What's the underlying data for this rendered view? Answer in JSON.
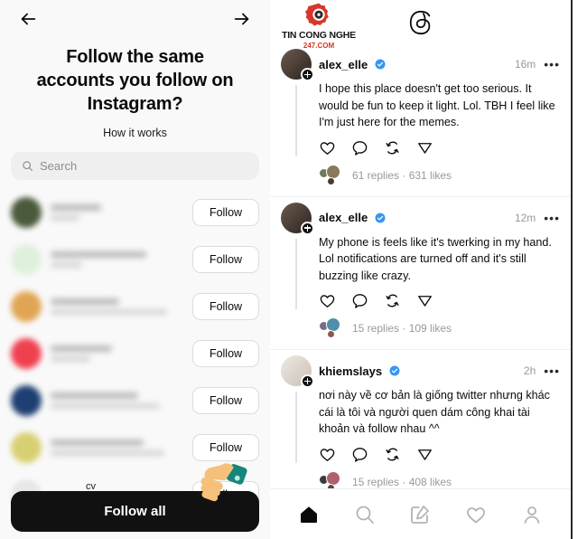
{
  "left_panel": {
    "back_icon": "arrow-left-icon",
    "forward_icon": "arrow-right-icon",
    "title": "Follow the same accounts you follow on Instagram?",
    "subtitle": "How it works",
    "search": {
      "placeholder": "Search",
      "icon": "search-icon"
    },
    "follow_button_label": "Follow",
    "follow_all_label": "Follow all",
    "pointer_emoji": "pointing-hand-emoji",
    "partial_row_label": "cv",
    "accounts": [
      {
        "avatar_color": "#4a5a3c"
      },
      {
        "avatar_color": "#dff0dc"
      },
      {
        "avatar_color": "#e0a554"
      },
      {
        "avatar_color": "#ef4050"
      },
      {
        "avatar_color": "#1e3f72"
      },
      {
        "avatar_color": "#d8cf72"
      }
    ]
  },
  "right_panel": {
    "watermark": {
      "name": "TIN CONG NGHE",
      "site": "247.COM",
      "accent": "#d6372a"
    },
    "logo": "threads-logo",
    "verified_color": "#3797f0",
    "posts": [
      {
        "username": "alex_elle",
        "verified": true,
        "time": "16m",
        "text": "I hope this place doesn't get too serious. It would be fun to keep it light. Lol. TBH I feel like I'm just here for the memes.",
        "stats": "61 replies · 631 likes",
        "avatar_color": "#3a3230",
        "reply_avatars": [
          "#6b7b5c",
          "#8a7a5c",
          "#4a3a34"
        ]
      },
      {
        "username": "alex_elle",
        "verified": true,
        "time": "12m",
        "text": "My phone is feels like it's twerking in my hand. Lol notifications are turned off and it's still buzzing like crazy.",
        "stats": "15 replies · 109 likes",
        "avatar_color": "#3a3230",
        "reply_avatars": [
          "#7a6a8a",
          "#4f8fa8",
          "#8a5a4a"
        ]
      },
      {
        "username": "khiemslays",
        "verified": true,
        "time": "2h",
        "text": "nơi này về cơ bản là giống twitter nhưng khác cái là tôi và người quen dám công khai tài khoản và follow nhau ^^",
        "stats": "15 replies · 408 likes",
        "avatar_color": "#d8d2cc",
        "reply_avatars": [
          "#3a3a3a",
          "#b0606c",
          "#5a4a42"
        ]
      }
    ],
    "actions": [
      "like-icon",
      "comment-icon",
      "repost-icon",
      "share-icon"
    ],
    "nav": [
      "home-icon",
      "search-icon",
      "compose-icon",
      "activity-icon",
      "profile-icon"
    ]
  }
}
